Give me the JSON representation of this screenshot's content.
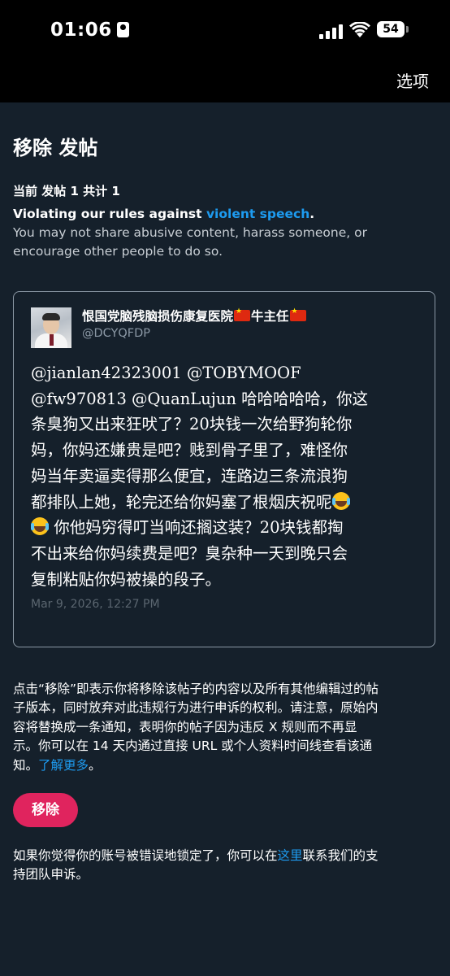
{
  "status_bar": {
    "time": "01:06",
    "battery": "54"
  },
  "nav": {
    "options_label": "选项"
  },
  "page": {
    "title": "移除 发帖",
    "count_label": "当前 发帖 1 共计 1",
    "rule_prefix": "Violating our rules against ",
    "rule_link": "violent speech",
    "rule_suffix": ".",
    "rule_description_lines": [
      "You may not share abusive content, harass someone, or",
      "encourage other people to do so."
    ]
  },
  "post": {
    "author_name_part1": "恨国党脑残脑损伤康复医院",
    "author_name_part2": "牛主任",
    "handle": "@DCYQFDP",
    "body_lines": [
      "@jianlan42323001 @TOBYMOOF",
      "@fw970813 @QuanLujun 哈哈哈哈哈，你这",
      "条臭狗又出来狂吠了？20块钱一次给野狗轮你",
      "妈，你妈还嫌贵是吧？贱到骨子里了，难怪你",
      "妈当年卖逼卖得那么便宜，连路边三条流浪狗",
      "都排队上她，轮完还给你妈塞了根烟庆祝呢",
      " 你他妈穷得叮当响还搁这装？20块钱都掏",
      "不出来给你妈续费是吧？臭杂种一天到晚只会",
      "复制粘贴你妈被操的段子。"
    ],
    "timestamp": "Mar 9, 2026, 12:27 PM"
  },
  "notice": {
    "lines": [
      "点击“移除”即表示你将移除该帖子的内容以及所有其他编辑过的帖",
      "子版本，同时放弃对此违规行为进行申诉的权利。请注意，原始内",
      "容将替换成一条通知，表明你的帖子因为违反 X 规则而不再显",
      "示。你可以在 14 天内通过直接 URL 或个人资料时间线查看该通",
      "知。"
    ],
    "learn_more": "了解更多",
    "learn_more_suffix": "。"
  },
  "remove_button_label": "移除",
  "appeal": {
    "line1_prefix": "如果你觉得你的账号被错误地锁定了，你可以在",
    "line1_link": "这里",
    "line1_suffix": "联系我们的支",
    "line2": "持团队申诉。"
  },
  "icons": [
    "signal-icon",
    "wifi-icon",
    "battery-icon",
    "id-card-icon",
    "china-flag-icon",
    "tears-of-joy-emoji"
  ],
  "colors": {
    "background": "#15202b",
    "link": "#1d9bf0",
    "danger": "#e0245e",
    "muted": "#8b98a5"
  }
}
